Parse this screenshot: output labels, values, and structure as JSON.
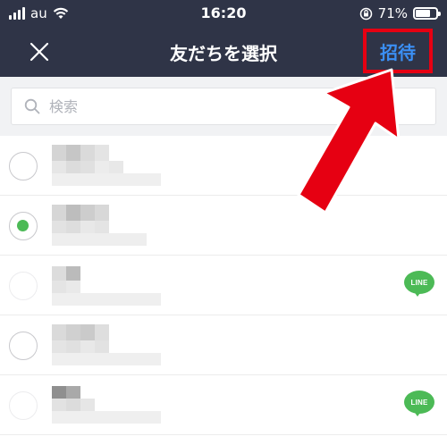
{
  "status_bar": {
    "carrier": "au",
    "time": "16:20",
    "battery": "71%",
    "battery_level": 0.71
  },
  "nav": {
    "title": "友だちを選択",
    "invite_label": "招待",
    "close_icon": "close-icon"
  },
  "search": {
    "placeholder": "検索",
    "icon": "search-icon"
  },
  "friends": [
    {
      "selected": false,
      "line_badge": false
    },
    {
      "selected": true,
      "line_badge": false
    },
    {
      "selected": false,
      "line_badge": true
    },
    {
      "selected": false,
      "line_badge": false
    },
    {
      "selected": false,
      "line_badge": true
    }
  ],
  "badge": {
    "label": "LINE"
  },
  "colors": {
    "header_bg": "#2f3447",
    "invite_text": "#3b8ff4",
    "highlight_red": "#e60012",
    "check_green": "#4cba56"
  }
}
